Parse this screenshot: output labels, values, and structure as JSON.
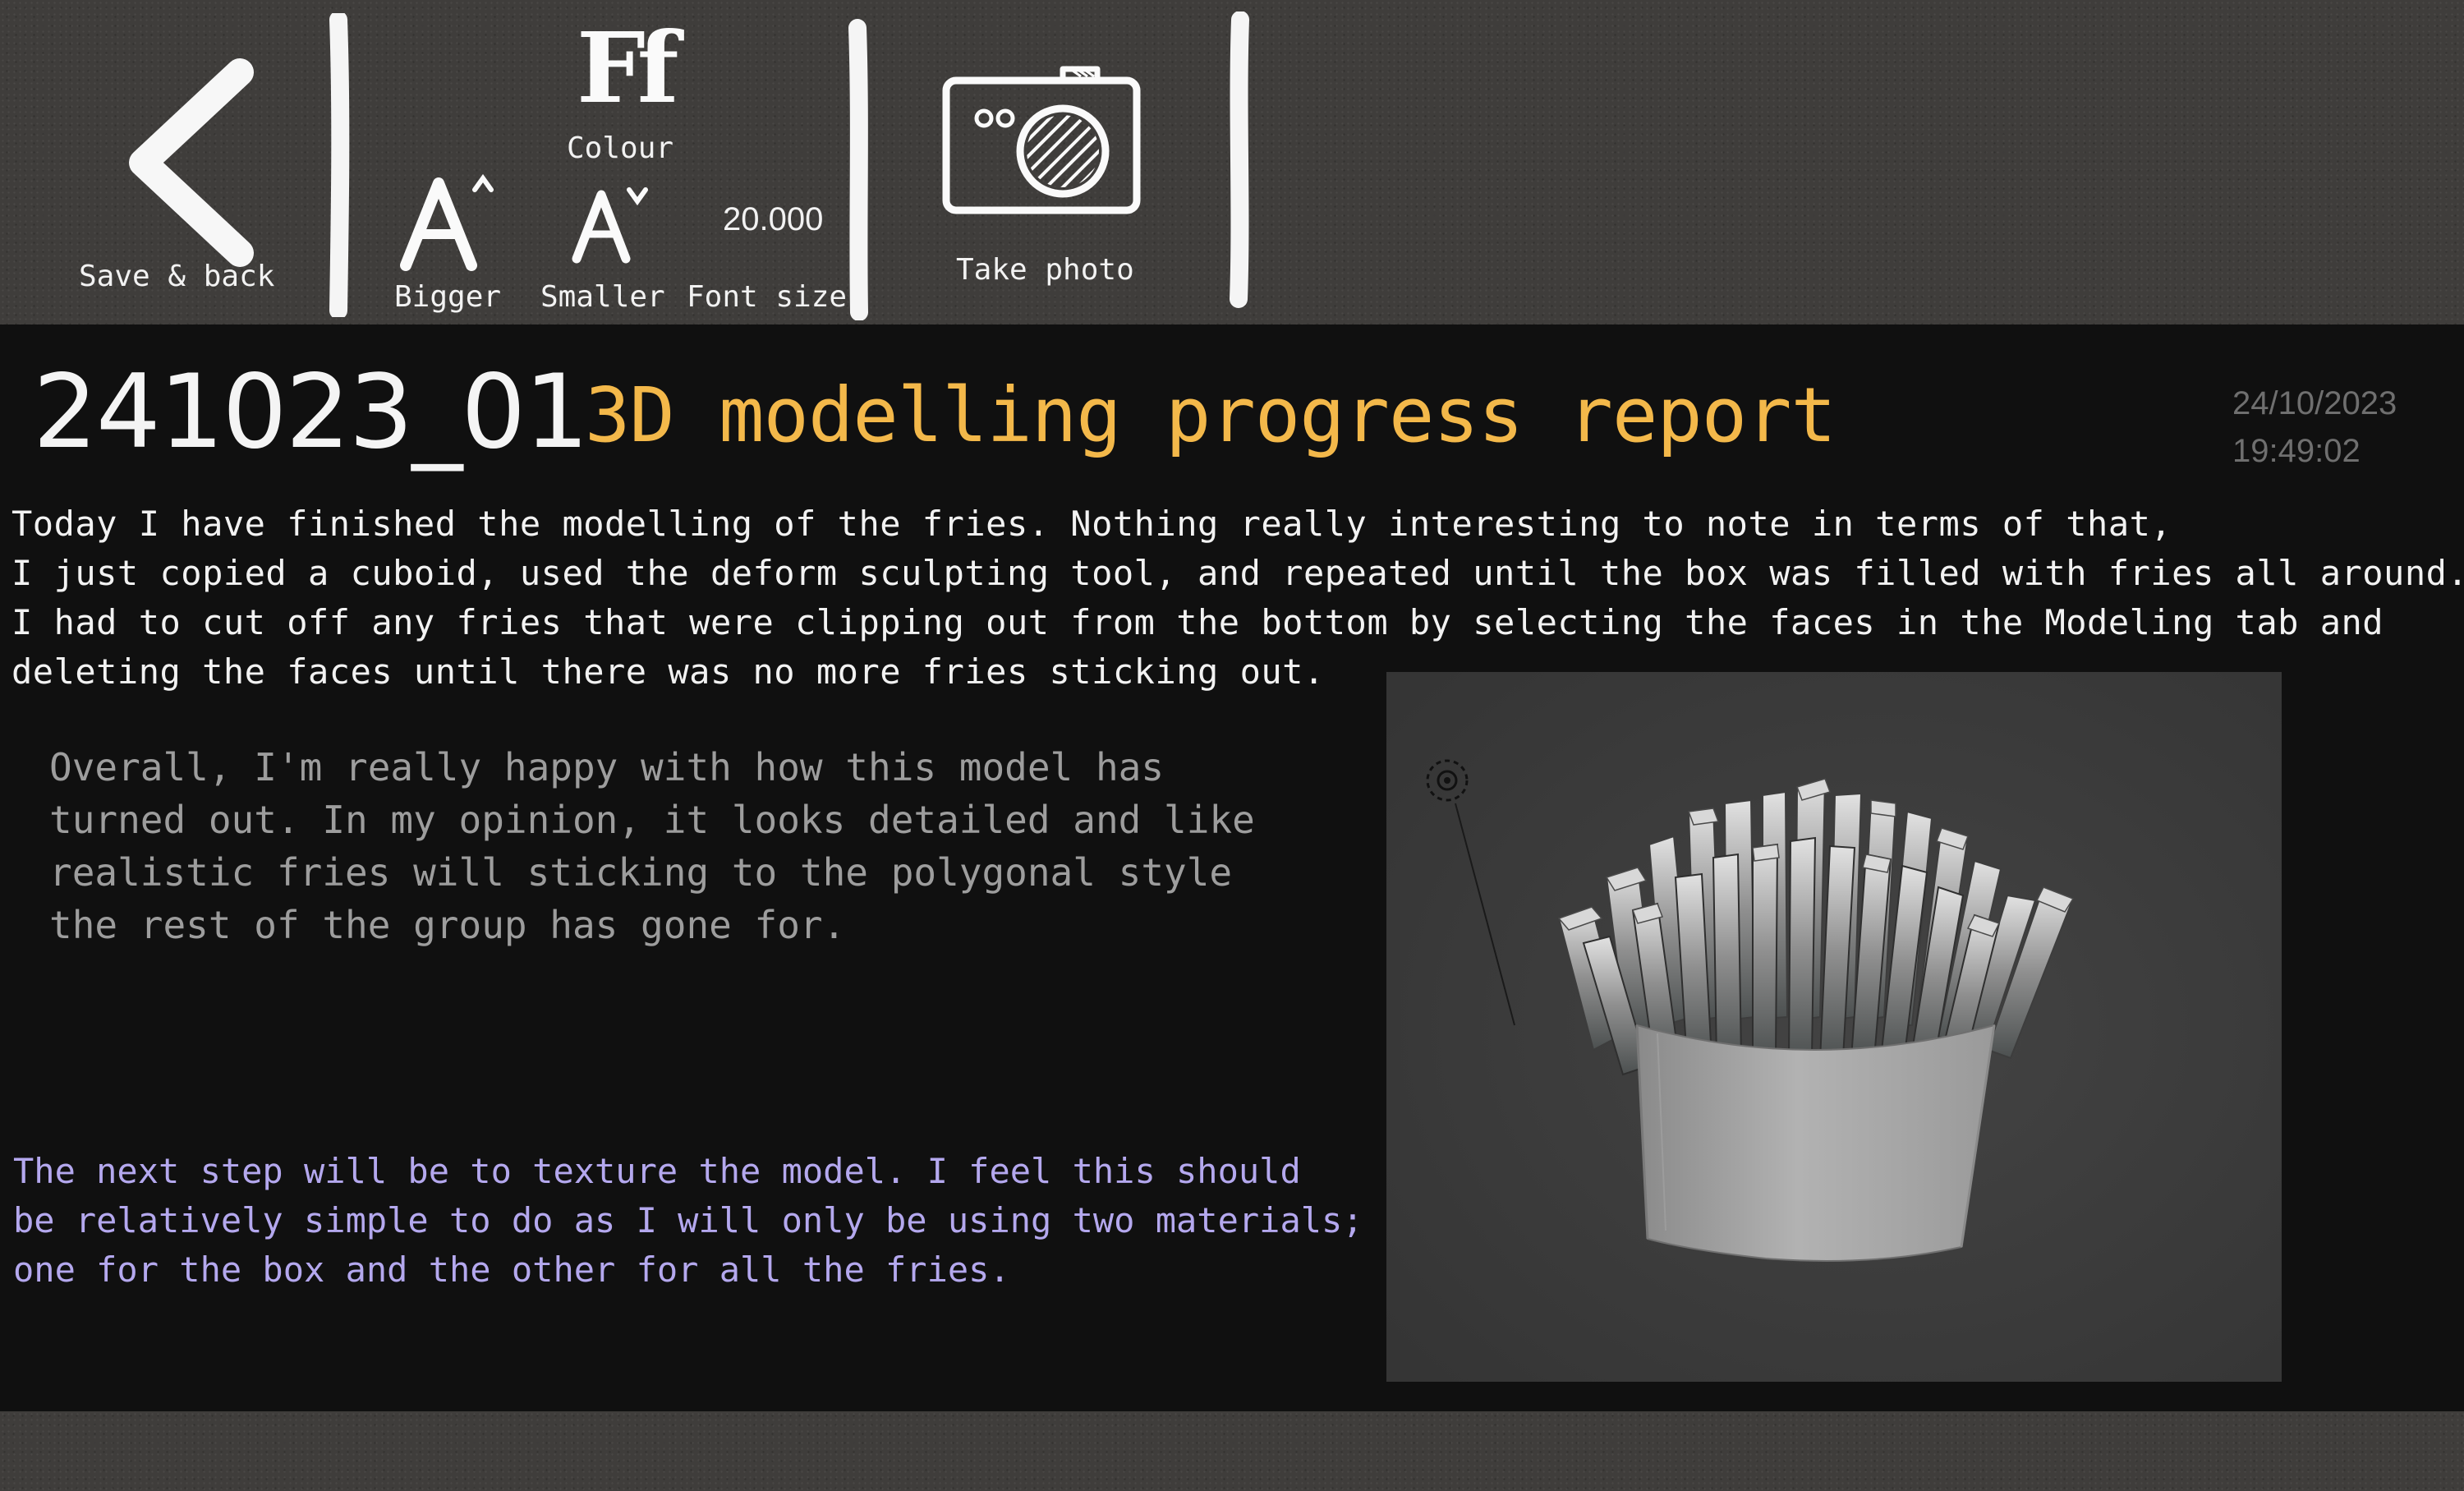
{
  "toolbar": {
    "save_back_label": "Save & back",
    "colour_label": "Colour",
    "colour_icon_glyph": "Ff",
    "bigger_label": "Bigger",
    "smaller_label": "Smaller",
    "font_size_label": "Font size",
    "font_size_value": "20.000",
    "take_photo_label": "Take photo"
  },
  "note": {
    "id": "241023_01",
    "title": "3D modelling progress report",
    "date": "24/10/2023",
    "time": "19:49:02",
    "paragraph1": [
      "Today I have finished the modelling of the fries. Nothing really interesting to note in terms of that,",
      "I just copied a cuboid, used the deform sculpting tool, and repeated until the box was filled with fries all around.",
      "I had to cut off any fries that were clipping out from the bottom by selecting the faces in the Modeling tab and",
      "deleting the faces until there was no more fries sticking out."
    ],
    "paragraph2": [
      "Overall, I'm really happy with how this model has",
      "turned out. In my opinion, it looks detailed and like",
      "realistic fries will sticking to the polygonal style",
      "the rest of the group has gone for."
    ],
    "paragraph3": [
      "The next step will be to texture the model. I feel this should",
      "be relatively simple to do as I will only be using two materials;",
      "one for the box and the other for all the fries."
    ]
  },
  "colors": {
    "title": "#f3b84a",
    "body_text": "#f2f2f2",
    "muted_text": "#9d9d9d",
    "accent_text": "#b4a8ee",
    "toolbar_bg": "#3f3d3b",
    "page_bg": "#101010"
  },
  "icons": [
    "back-arrow-icon",
    "font-colour-icon",
    "bigger-font-icon",
    "smaller-font-icon",
    "camera-icon"
  ]
}
